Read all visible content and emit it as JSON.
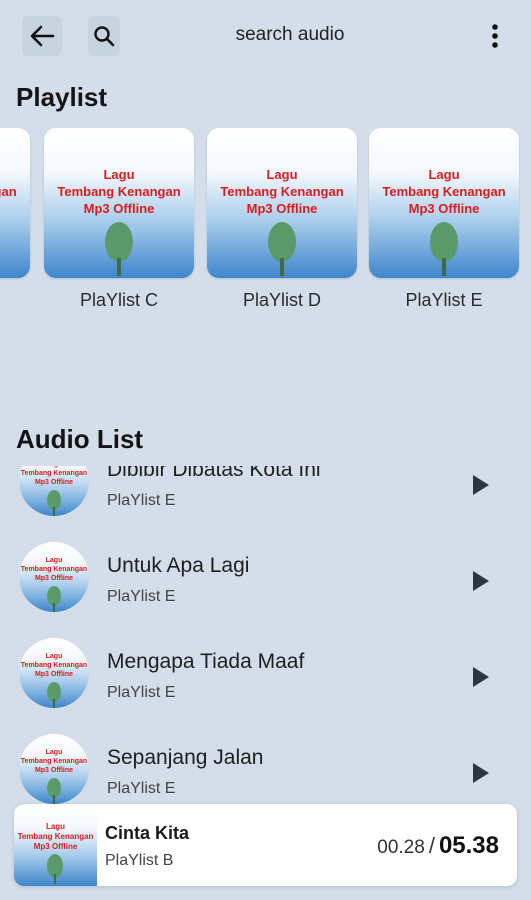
{
  "header": {
    "search_label": "search audio",
    "icons": [
      "arrow-left-icon",
      "search-icon",
      "more-vertical-icon"
    ]
  },
  "playlist_section": {
    "title": "Playlist",
    "cover_text": [
      "Lagu",
      "Tembang Kenangan",
      "Mp3 Offline"
    ],
    "items": [
      {
        "name": ""
      },
      {
        "name": "PlaYlist C"
      },
      {
        "name": "PlaYlist D"
      },
      {
        "name": "PlaYlist E"
      }
    ]
  },
  "audio_section": {
    "title": "Audio List",
    "thumb_text": [
      "Lagu",
      "Tembang Kenangan",
      "Mp3 Offline"
    ],
    "items": [
      {
        "title": "Dibibir Dibatas Kota Ini",
        "playlist": "PlaYlist E"
      },
      {
        "title": "Untuk Apa Lagi",
        "playlist": "PlaYlist E"
      },
      {
        "title": "Mengapa Tiada Maaf",
        "playlist": "PlaYlist E"
      },
      {
        "title": "Sepanjang Jalan",
        "playlist": "PlaYlist E"
      }
    ]
  },
  "player": {
    "title": "Cinta Kita",
    "playlist": "PlaYlist B",
    "current_time": "00.28",
    "separator": "/",
    "total_time": "05.38",
    "progress": 0.087
  },
  "colors": {
    "background": "#d3deea",
    "cover_text": "#d81d1d",
    "cover_blue": "#3e86cc"
  }
}
